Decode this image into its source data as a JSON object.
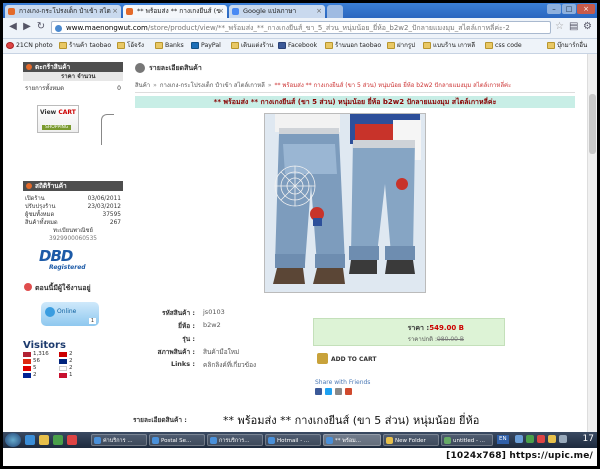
{
  "browser": {
    "tabs": [
      {
        "label": "กางเกง-กระโปรงเด็ก ปำเข้า สไต"
      },
      {
        "label": "** พร้อมส่ง ** กางเกงยีนส์ (ข"
      },
      {
        "label": "Google แปลภาษา"
      }
    ],
    "url_domain": "www.maenongwut.com",
    "url_path": "/store/product/view/**_พร้อมส่ง_**_กางเกงยีนส์_ขา_5_ส่วน_หนุ่มน้อย_ยี่ห้อ_b2w2_ปักลายแมงมุม_สไตล์เกาหลี่ค่ะ-2",
    "bookmarks": [
      {
        "label": "21CN photo",
        "icon": "red"
      },
      {
        "label": "ร้านค้า taobao",
        "icon": "folder"
      },
      {
        "label": "โอ้จรัง",
        "icon": "folder"
      },
      {
        "label": "Banks",
        "icon": "folder"
      },
      {
        "label": "PayPal",
        "icon": "pp"
      },
      {
        "label": "เดินแต่งร้าน",
        "icon": "folder"
      },
      {
        "label": "Facebook",
        "icon": "blue"
      },
      {
        "label": "ร้านนอก taobao",
        "icon": "folder"
      },
      {
        "label": "ฝากรูป",
        "icon": "folder"
      },
      {
        "label": "แบบร้าน เกาหลี",
        "icon": "folder"
      },
      {
        "label": "css code",
        "icon": "folder"
      },
      {
        "label": "บุ๊กมาร์กอื่น",
        "icon": "folder"
      }
    ]
  },
  "sidebar": {
    "cart_title": "ตะกร้าสินค้า",
    "cart_cols": "ราคา   จำนวน",
    "cart_total_label": "รายการทั้งหมด",
    "cart_total_value": "0",
    "view_cart_label": "View",
    "view_cart_accent": "CART",
    "shopping_label": "SHOPPING",
    "stats_title": "สถิติร้านค้า",
    "stats": [
      {
        "label": "เปิดร้าน",
        "value": "03/06/2011"
      },
      {
        "label": "ปรับปรุงร้าน",
        "value": "23/03/2012"
      },
      {
        "label": "ผู้ชมทั้งหมด",
        "value": "37595"
      },
      {
        "label": "สินค้าทั้งหมด",
        "value": "267"
      }
    ],
    "registration_label": "ทะเบียนพาณิชย์",
    "registration_number": "3929900060535",
    "dbd_logo": "DBD",
    "dbd_sub": "Registered",
    "online_title": "ตอนนี้มีผู้ใช้งานอยู่",
    "online_label": "Online",
    "online_count": "1",
    "visitors_title": "Visitors",
    "visitors": [
      {
        "a": "1,316",
        "b": "2",
        "c1": "#b22234",
        "c2": "#c00"
      },
      {
        "a": "56",
        "b": "2",
        "c1": "#de2910",
        "c2": "#00247d"
      },
      {
        "a": "5",
        "b": "2",
        "c1": "#dd0000",
        "c2": "#fff"
      },
      {
        "a": "2",
        "b": "1",
        "c1": "#002395",
        "c2": "#c8102e"
      }
    ]
  },
  "main": {
    "header": "รายละเอียดสินค้า",
    "breadcrumb": [
      "สินค้า",
      "กางเกง-กระโปรงเด็ก ปำเข้า สไตล์เกาหลี",
      "** พร้อมส่ง ** กางเกงยีนส์ (ขา 5 ส่วน) หนุ่มน้อย ยี่ห้อ b2w2 ปักลายแมงมุม สไตล์เกาหลี่ค่ะ"
    ],
    "title": "** พร้อมส่ง ** กางเกงยีนส์ (ขา 5 ส่วน) หนุ่มน้อย ยี่ห้อ b2w2 ปักลายแมงมุม สไตล์เกาหลี่ค่ะ",
    "details": [
      {
        "label": "รหัสสินค้า :",
        "value": "js0103"
      },
      {
        "label": "ยี่ห้อ :",
        "value": "b2w2"
      },
      {
        "label": "รุ่น :",
        "value": ""
      },
      {
        "label": "สภาพสินค้า :",
        "value": "สินค้ามือใหม่"
      },
      {
        "label": "Links :",
        "value": "คลิกลิงค์ที่เกี่ยวข้อง"
      }
    ],
    "price_label": "ราคา :",
    "price": "549.00 B",
    "normal_price_label": "ราคาปกติ :",
    "normal_price": "980.00 B",
    "add_to_cart": "ADD TO CART",
    "share_label": "Share with Friends",
    "desc_label": "รายละเอียดสินค้า :",
    "desc_text": "** พร้อมส่ง **  กางเกงยีนส์ (ขา 5 ส่วน) หนุ่มน้อย ยี่ห้อ"
  },
  "taskbar": {
    "items": [
      {
        "label": "",
        "color": "#3b8ed8"
      },
      {
        "label": "ค่าบริการ ...",
        "color": "#4a90d9"
      },
      {
        "label": "Postal Se...",
        "color": "#4a90d9"
      },
      {
        "label": "การบริการ...",
        "color": "#4a90d9"
      },
      {
        "label": "Hotmail - ...",
        "color": "#4a90d9"
      },
      {
        "label": "** พร้อม...",
        "color": "#4a90d9"
      },
      {
        "label": "New Folder",
        "color": "#e7c04b"
      },
      {
        "label": "untitled - ...",
        "color": "#6a6"
      },
      {
        "label": "",
        "color": "#c44"
      }
    ],
    "lang": "EN",
    "clock": "17"
  },
  "footer": {
    "credit": "[1024x768] https://upic.me/"
  }
}
